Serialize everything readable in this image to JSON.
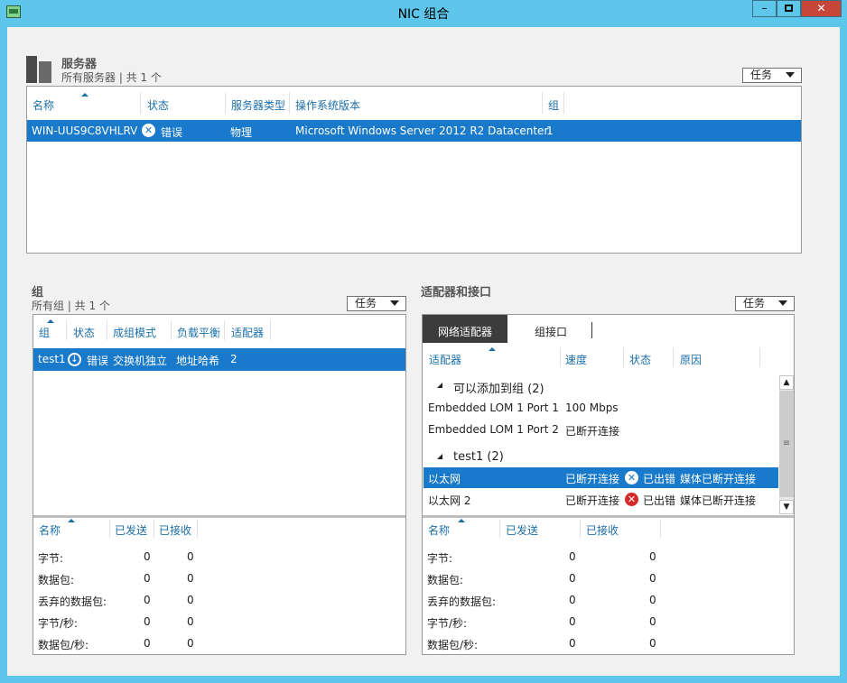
{
  "window": {
    "title": "NIC 组合",
    "min_label": "–",
    "close_label": "✕"
  },
  "servers": {
    "title": "服务器",
    "subtitle": "所有服务器 | 共 1 个",
    "tasks_label": "任务",
    "columns": [
      "名称",
      "状态",
      "服务器类型",
      "操作系统版本",
      "组"
    ],
    "row": {
      "name": "WIN-UUS9C8VHLRV",
      "status": "错误",
      "type": "物理",
      "os": "Microsoft Windows Server 2012 R2 Datacenter",
      "group": "1"
    }
  },
  "teams": {
    "title": "组",
    "subtitle": "所有组 | 共 1 个",
    "tasks_label": "任务",
    "columns": [
      "组",
      "状态",
      "成组模式",
      "负载平衡",
      "适配器"
    ],
    "row": {
      "name": "test1",
      "status": "错误",
      "mode": "交换机独立",
      "lb": "地址哈希",
      "adapters": "2"
    },
    "stats_columns": [
      "名称",
      "已发送",
      "已接收"
    ],
    "stats": [
      {
        "label": "字节:",
        "sent": "0",
        "recv": "0"
      },
      {
        "label": "数据包:",
        "sent": "0",
        "recv": "0"
      },
      {
        "label": "丢弃的数据包:",
        "sent": "0",
        "recv": "0"
      },
      {
        "label": "字节/秒:",
        "sent": "0",
        "recv": "0"
      },
      {
        "label": "数据包/秒:",
        "sent": "0",
        "recv": "0"
      }
    ]
  },
  "adapters": {
    "title": "适配器和接口",
    "tasks_label": "任务",
    "tabs": [
      "网络适配器",
      "组接口"
    ],
    "columns": [
      "适配器",
      "速度",
      "状态",
      "原因"
    ],
    "group_available": "可以添加到组 (2)",
    "available": [
      {
        "name": "Embedded LOM 1 Port 1",
        "speed": "100 Mbps"
      },
      {
        "name": "Embedded LOM 1 Port 2",
        "speed": "已断开连接"
      }
    ],
    "group_team": "test1 (2)",
    "members": [
      {
        "name": "以太网",
        "speed": "已断开连接",
        "status": "已出错",
        "reason": "媒体已断开连接"
      },
      {
        "name": "以太网 2",
        "speed": "已断开连接",
        "status": "已出错",
        "reason": "媒体已断开连接"
      }
    ],
    "stats_columns": [
      "名称",
      "已发送",
      "已接收"
    ],
    "stats": [
      {
        "label": "字节:",
        "sent": "0",
        "recv": "0"
      },
      {
        "label": "数据包:",
        "sent": "0",
        "recv": "0"
      },
      {
        "label": "丢弃的数据包:",
        "sent": "0",
        "recv": "0"
      },
      {
        "label": "字节/秒:",
        "sent": "0",
        "recv": "0"
      },
      {
        "label": "数据包/秒:",
        "sent": "0",
        "recv": "0"
      }
    ]
  },
  "colors": {
    "titlebar": "#5ec6eb",
    "selection": "#1979ca",
    "header_text": "#1b6fa8",
    "error_red": "#d42a2a"
  },
  "icons": {
    "app": "nic-app-icon",
    "servers": "server-icon",
    "error": "error-x-icon",
    "down": "down-arrow-icon"
  }
}
